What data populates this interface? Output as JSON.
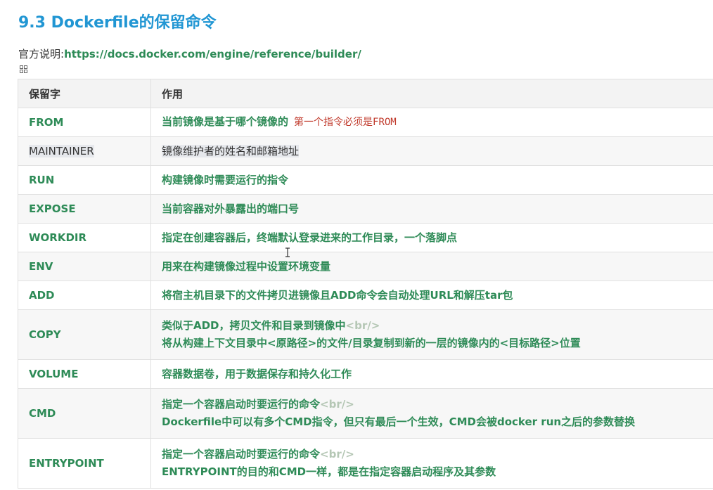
{
  "title": "9.3 Dockerfile的保留命令",
  "official": {
    "label": "官方说明:",
    "link": "https://docs.docker.com/engine/reference/builder/"
  },
  "table": {
    "headers": [
      "保留字",
      "作用"
    ],
    "rows": [
      {
        "key": "FROM",
        "desc": "当前镜像是基于哪个镜像的",
        "note": "第一个指令必须是FROM"
      },
      {
        "key": "MAINTAINER",
        "desc": "镜像维护者的姓名和邮箱地址"
      },
      {
        "key": "RUN",
        "desc": "构建镜像时需要运行的指令"
      },
      {
        "key": "EXPOSE",
        "desc": "当前容器对外暴露出的端口号"
      },
      {
        "key": "WORKDIR",
        "desc": "指定在创建容器后，终端默认登录进来的工作目录，一个落脚点"
      },
      {
        "key": "ENV",
        "desc": "用来在构建镜像过程中设置环境变量"
      },
      {
        "key": "ADD",
        "desc": "将宿主机目录下的文件拷贝进镜像且ADD命令会自动处理URL和解压tar包"
      },
      {
        "key": "COPY",
        "desc": "类似于ADD，拷贝文件和目录到镜像中",
        "br": "<br/>",
        "desc2": "将从构建上下文目录中<原路径>的文件/目录复制到新的一层的镜像内的<目标路径>位置"
      },
      {
        "key": "VOLUME",
        "desc": "容器数据卷，用于数据保存和持久化工作"
      },
      {
        "key": "CMD",
        "desc": "指定一个容器启动时要运行的命令",
        "br": "<br/>",
        "desc2": "Dockerfile中可以有多个CMD指令，但只有最后一个生效，CMD会被docker run之后的参数替换"
      },
      {
        "key": "ENTRYPOINT",
        "desc": "指定一个容器启动时要运行的命令",
        "br": "<br/>",
        "desc2": "ENTRYPOINT的目的和CMD一样，都是在指定容器启动程序及其参数"
      }
    ]
  }
}
